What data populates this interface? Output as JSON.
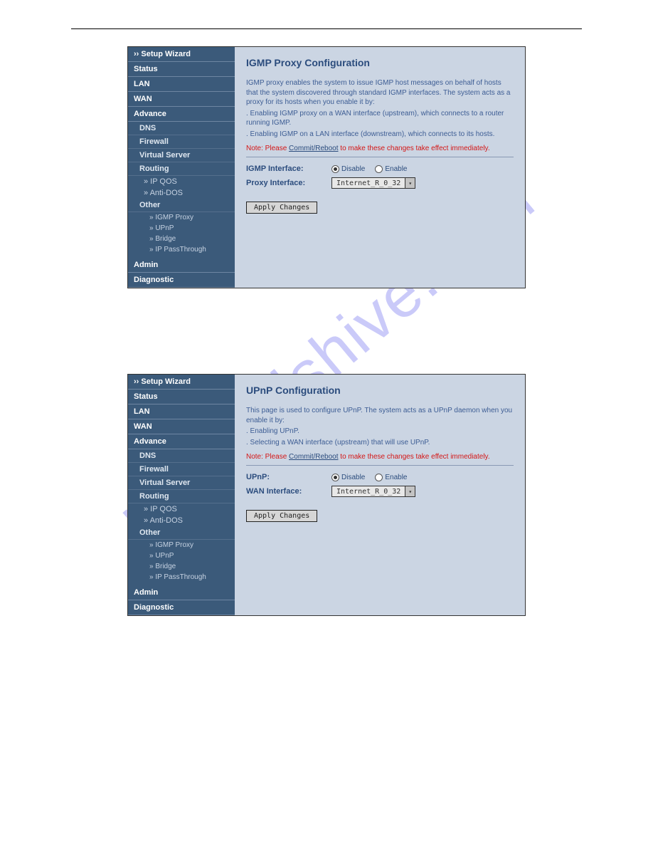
{
  "watermark": "manualshive.com",
  "sidebar": {
    "setup": "›› Setup Wizard",
    "status": "Status",
    "lan": "LAN",
    "wan": "WAN",
    "advance": "Advance",
    "dns": "DNS",
    "firewall": "Firewall",
    "virtual_server": "Virtual Server",
    "routing": "Routing",
    "ipqos": "» IP QOS",
    "antidos": "» Anti-DOS",
    "other": "Other",
    "igmp_proxy": "» IGMP Proxy",
    "upnp": "» UPnP",
    "bridge": "» Bridge",
    "ip_pass": "» IP PassThrough",
    "admin": "Admin",
    "diagnostic": "Diagnostic"
  },
  "igmp": {
    "title": "IGMP Proxy Configuration",
    "intro1": "IGMP proxy enables the system to issue IGMP host messages on behalf of hosts that the system discovered through standard IGMP interfaces. The system acts as a proxy for its hosts when you enable it by:",
    "intro2": ". Enabling IGMP proxy on a WAN interface (upstream), which connects to a router running IGMP.",
    "intro3": ". Enabling IGMP on a LAN interface (downstream), which connects to its hosts.",
    "note_prefix": "Note: Please ",
    "note_link": "Commit/Reboot",
    "note_suffix": " to make these changes take effect immediately.",
    "field_interface": "IGMP Interface:",
    "field_proxy": "Proxy Interface:",
    "radio_disable": "Disable",
    "radio_enable": "Enable",
    "select_value": "Internet_R_0_32",
    "btn_apply": "Apply Changes"
  },
  "upnp": {
    "title": "UPnP Configuration",
    "intro1": "This page is used to configure UPnP. The system acts as a UPnP daemon when you enable it by:",
    "intro2": ". Enabling UPnP.",
    "intro3": ". Selecting a WAN interface (upstream) that will use UPnP.",
    "note_prefix": "Note: Please ",
    "note_link": "Commit/Reboot",
    "note_suffix": " to make these changes take effect immediately.",
    "field_upnp": "UPnP:",
    "field_wan": "WAN Interface:",
    "radio_disable": "Disable",
    "radio_enable": "Enable",
    "select_value": "Internet_R_0_32",
    "btn_apply": "Apply Changes"
  }
}
